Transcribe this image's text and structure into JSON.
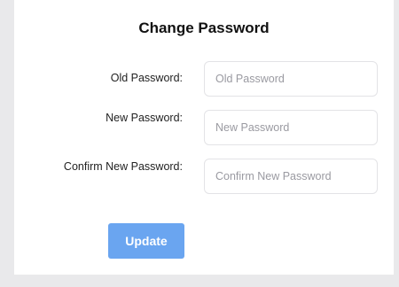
{
  "form": {
    "title": "Change Password",
    "fields": [
      {
        "label": "Old Password:",
        "value": "",
        "placeholder": "Old Password"
      },
      {
        "label": "New Password:",
        "value": "",
        "placeholder": "New Password"
      },
      {
        "label": "Confirm New Password:",
        "value": "",
        "placeholder": "Confirm New Password"
      }
    ],
    "submit_label": "Update"
  },
  "colors": {
    "page_background": "#e9e9eb",
    "card_background": "#ffffff",
    "button_background": "#6aa5f0",
    "button_text": "#ffffff",
    "field_border": "#e3e3e6",
    "placeholder_text": "#9a9aa1"
  }
}
